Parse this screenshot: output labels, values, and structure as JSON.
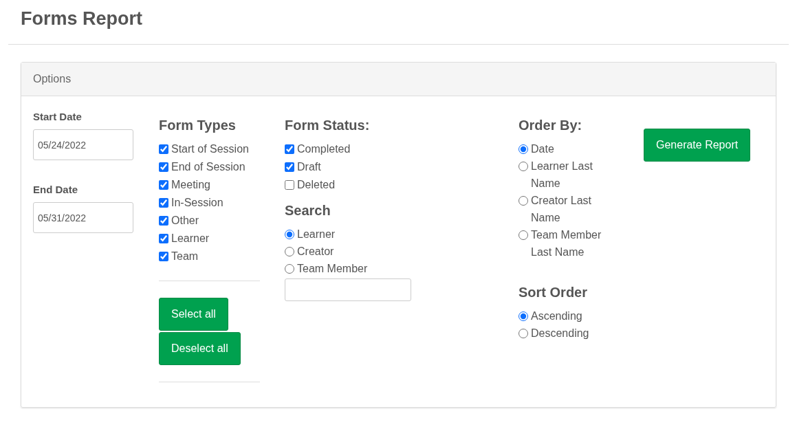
{
  "page": {
    "title": "Forms Report"
  },
  "options": {
    "header": "Options",
    "start_date": {
      "label": "Start Date",
      "value": "05/24/2022"
    },
    "end_date": {
      "label": "End Date",
      "value": "05/31/2022"
    },
    "form_types": {
      "heading": "Form Types",
      "items": [
        {
          "label": "Start of Session",
          "checked": true
        },
        {
          "label": "End of Session",
          "checked": true
        },
        {
          "label": "Meeting",
          "checked": true
        },
        {
          "label": "In-Session",
          "checked": true
        },
        {
          "label": "Other",
          "checked": true
        },
        {
          "label": "Learner",
          "checked": true
        },
        {
          "label": "Team",
          "checked": true
        }
      ]
    },
    "select_all": "Select all",
    "deselect_all": "Deselect all",
    "form_status": {
      "heading": "Form Status:",
      "items": [
        {
          "label": "Completed",
          "checked": true
        },
        {
          "label": "Draft",
          "checked": true
        },
        {
          "label": "Deleted",
          "checked": false
        }
      ]
    },
    "search": {
      "heading": "Search",
      "options": [
        {
          "label": "Learner",
          "selected": true
        },
        {
          "label": "Creator",
          "selected": false
        },
        {
          "label": "Team Member",
          "selected": false
        }
      ]
    },
    "order_by": {
      "heading": "Order By:",
      "options": [
        {
          "label": "Date",
          "selected": true
        },
        {
          "label": "Learner Last Name",
          "selected": false
        },
        {
          "label": "Creator Last Name",
          "selected": false
        },
        {
          "label": "Team Member Last Name",
          "selected": false
        }
      ]
    },
    "sort_order": {
      "heading": "Sort Order",
      "options": [
        {
          "label": "Ascending",
          "selected": true
        },
        {
          "label": "Descending",
          "selected": false
        }
      ]
    },
    "generate_button": "Generate Report"
  }
}
